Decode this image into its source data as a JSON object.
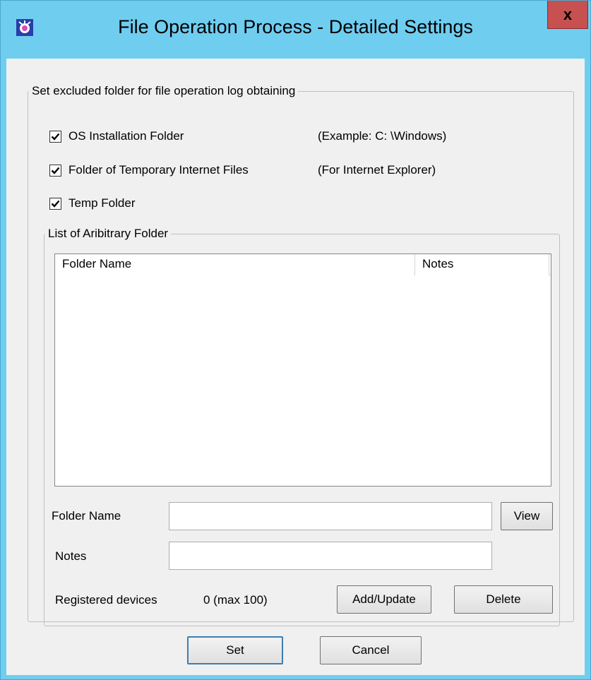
{
  "window": {
    "title": "File Operation Process - Detailed Settings",
    "close_label": "x"
  },
  "exclude_group": {
    "legend": "Set excluded folder for file operation log obtaining",
    "options": [
      {
        "label": "OS Installation Folder",
        "hint": "(Example: C: \\Windows)",
        "checked": true
      },
      {
        "label": "Folder of Temporary Internet Files",
        "hint": "(For Internet Explorer)",
        "checked": true
      },
      {
        "label": "Temp Folder",
        "hint": "",
        "checked": true
      }
    ]
  },
  "arbitrary_group": {
    "legend": "List of Aribitrary Folder",
    "columns": [
      "Folder Name",
      "Notes"
    ],
    "rows": [],
    "folder_name_label": "Folder Name",
    "folder_name_value": "",
    "view_button": "View",
    "notes_label": "Notes",
    "notes_value": "",
    "registered_label": "Registered devices",
    "registered_value": "0 (max 100)",
    "add_update_button": "Add/Update",
    "delete_button": "Delete"
  },
  "footer": {
    "set_button": "Set",
    "cancel_button": "Cancel"
  },
  "colors": {
    "titlebar": "#6fcdf0",
    "close_button": "#c75050",
    "client_bg": "#f0f0f0"
  }
}
